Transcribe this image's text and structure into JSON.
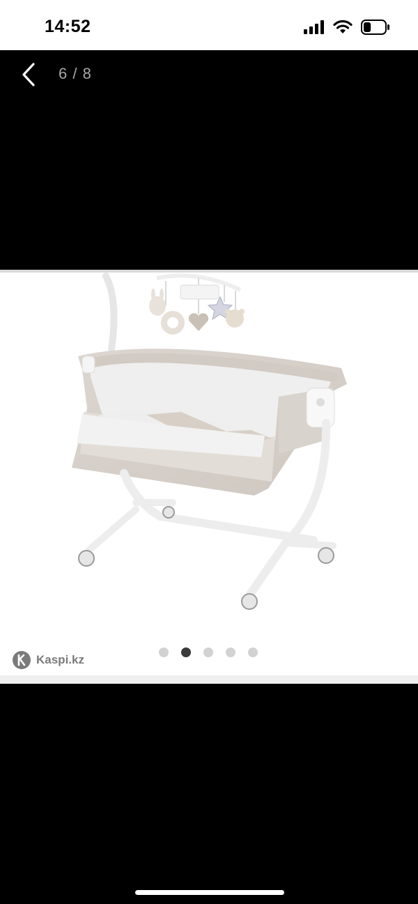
{
  "status_bar": {
    "time": "14:52",
    "battery_level": 0.35
  },
  "viewer": {
    "counter": "6 / 8",
    "back_icon": "chevron-left-icon"
  },
  "photo": {
    "description_icon": "baby-bedside-crib-photo",
    "carousel": {
      "total_dots": 5,
      "active_index": 1
    }
  },
  "watermark": {
    "brand": "Kaspi.kz",
    "icon": "kaspi-logo-icon"
  },
  "colors": {
    "background": "#000000",
    "frame": "#ffffff",
    "active_dot": "#3a3a3a",
    "inactive_dot": "#d2d2d2"
  }
}
